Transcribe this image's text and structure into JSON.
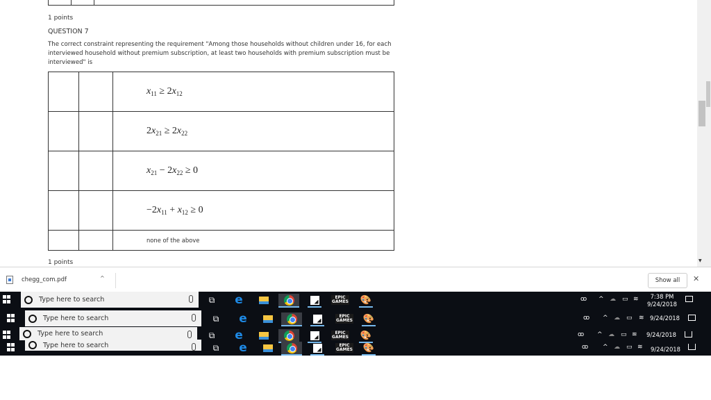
{
  "document": {
    "points_label": "1 points",
    "question_title": "QUESTION 7",
    "question_text": "The correct constraint representing the requirement \"Among those households without children under 16, for each interviewed household without premium subscription, at least two households with premium subscription must be interviewed\" is",
    "options": [
      {
        "id": "a",
        "kind": "math",
        "html": "x11 ≥ 2x12"
      },
      {
        "id": "b",
        "kind": "math",
        "html": "2x21 ≥ 2x22"
      },
      {
        "id": "c",
        "kind": "math",
        "html": "x21 − 2x22 ≥ 0"
      },
      {
        "id": "d",
        "kind": "math",
        "html": "−2x11 + x12 ≥ 0"
      },
      {
        "id": "e",
        "kind": "text",
        "html": "none of the above"
      }
    ],
    "next_points_label": "1 points"
  },
  "download_bar": {
    "file_name": "chegg_com.pdf",
    "show_all_label": "Show all",
    "close_label": "✕",
    "chevron": "^"
  },
  "taskbar": {
    "search_placeholder": "Type here to search",
    "time": "7:38 PM",
    "date": "9/24/2018",
    "apps": [
      "task-view",
      "edge",
      "file-explorer",
      "chrome",
      "sticky-notes",
      "epic-games",
      "paint"
    ],
    "active_app": "chrome",
    "epic_label": "EPIC GAMES"
  }
}
